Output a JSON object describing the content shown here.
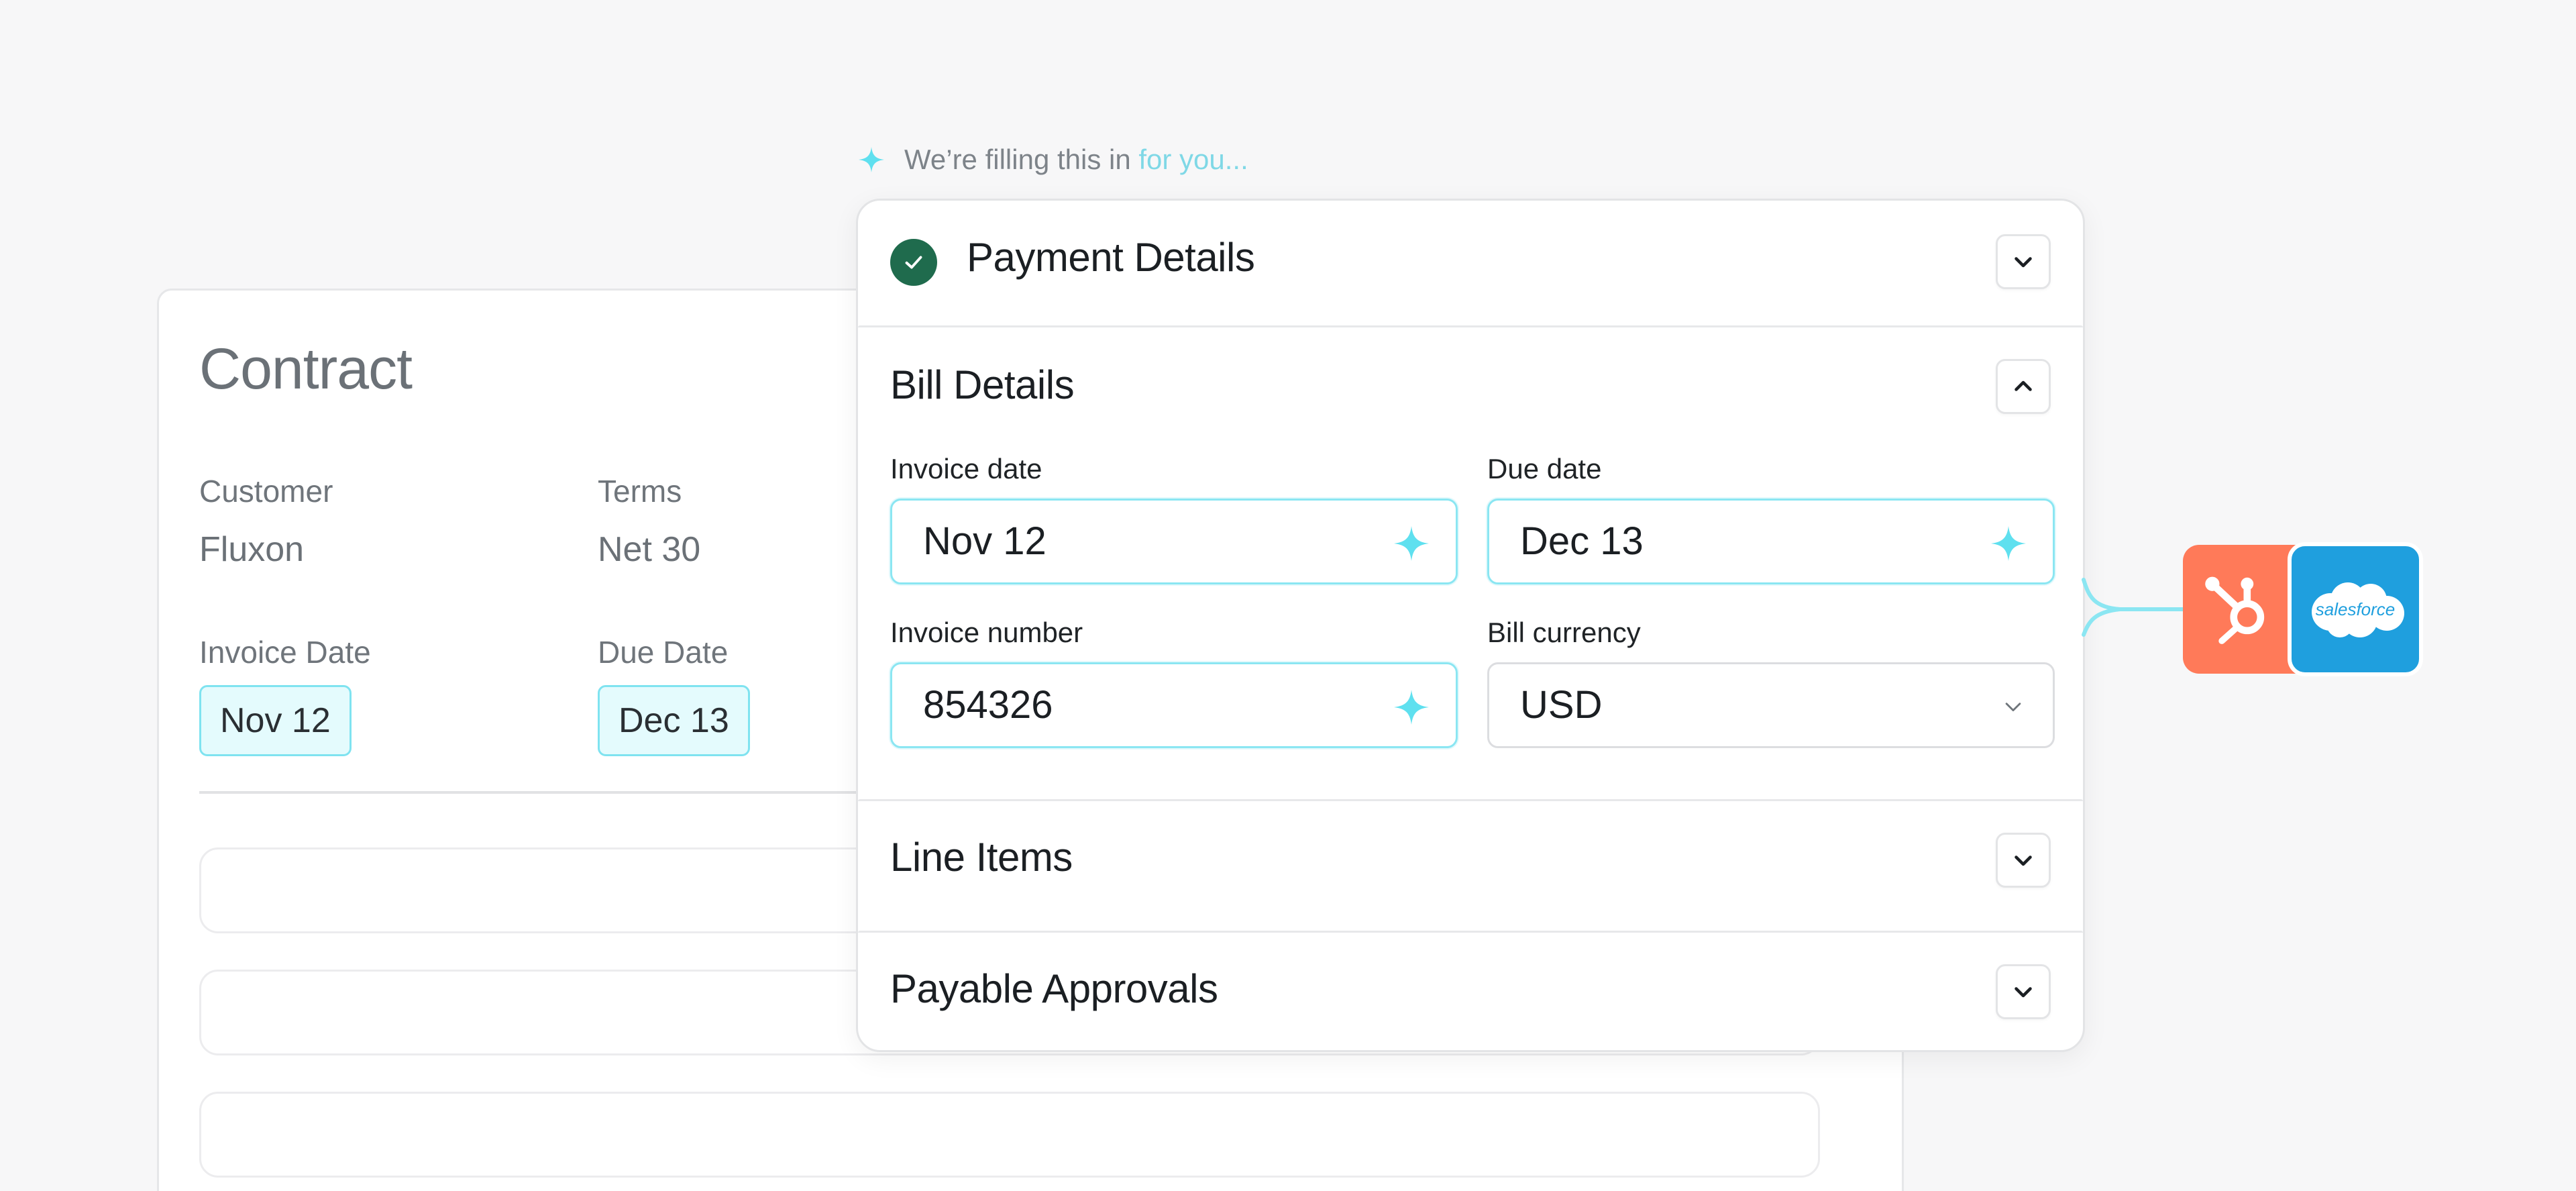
{
  "contract": {
    "title": "Contract",
    "customer_label": "Customer",
    "customer_value": "Fluxon",
    "terms_label": "Terms",
    "terms_value": "Net 30",
    "invoice_date_label": "Invoice Date",
    "invoice_date_value": "Nov 12",
    "due_date_label": "Due Date",
    "due_date_value": "Dec 13"
  },
  "hint": {
    "text_main": "We’re filling this in ",
    "text_fade": "for you..."
  },
  "panel": {
    "payment_details": {
      "title": "Payment Details",
      "status": "complete"
    },
    "bill_details": {
      "title": "Bill Details",
      "invoice_date_label": "Invoice date",
      "invoice_date_value": "Nov 12",
      "due_date_label": "Due date",
      "due_date_value": "Dec 13",
      "invoice_number_label": "Invoice number",
      "invoice_number_value": "854326",
      "bill_currency_label": "Bill currency",
      "bill_currency_value": "USD"
    },
    "line_items": {
      "title": "Line Items"
    },
    "payable_approvals": {
      "title": "Payable Approvals"
    }
  },
  "integrations": {
    "salesforce_logo_text": "salesforce"
  },
  "colors": {
    "accent_cyan": "#5fe0ef",
    "success_green": "#1f6b4d",
    "hubspot_orange": "#ff7a59",
    "salesforce_blue": "#1f9fde"
  },
  "icons": {
    "ai_fill": "sparkle-icon",
    "expand": "chevron-down-icon",
    "collapse": "chevron-up-icon",
    "complete": "check-circle-icon"
  }
}
